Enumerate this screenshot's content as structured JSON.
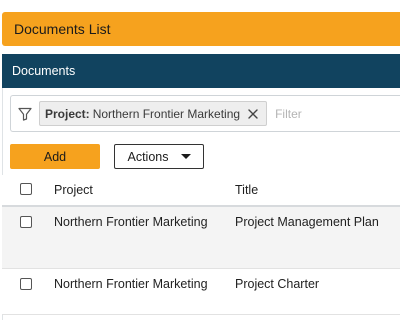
{
  "header": {
    "title": "Documents List"
  },
  "panel": {
    "title": "Documents"
  },
  "filter": {
    "chip_label": "Project:",
    "chip_value": "Northern Frontier Marketing",
    "placeholder": "Filter"
  },
  "toolbar": {
    "add_label": "Add",
    "actions_label": "Actions"
  },
  "table": {
    "columns": [
      "Project",
      "Title"
    ],
    "rows": [
      {
        "project": "Northern Frontier Marketing",
        "title": "Project Management Plan"
      },
      {
        "project": "Northern Frontier Marketing",
        "title": "Project Charter"
      }
    ]
  },
  "colors": {
    "accent": "#f6a21e",
    "panel_header": "#11435f"
  }
}
